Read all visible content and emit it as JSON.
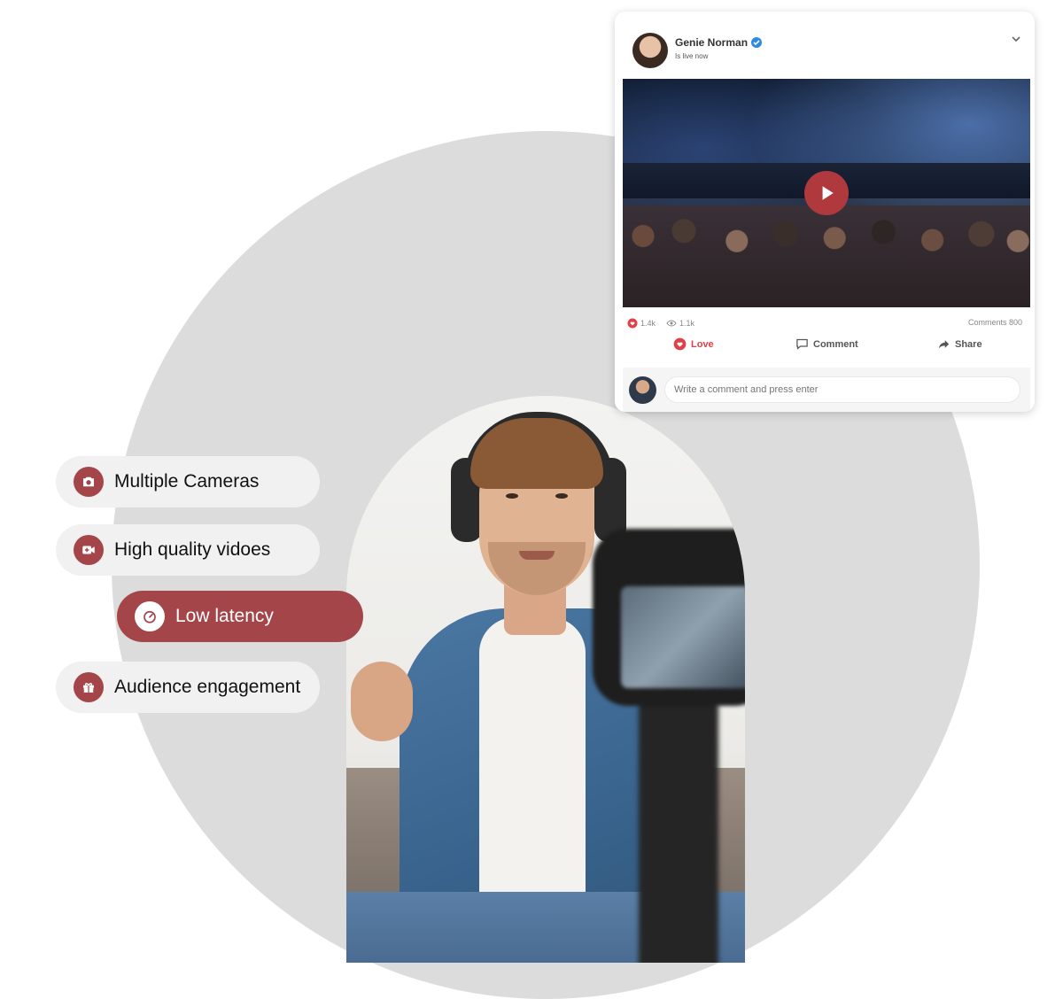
{
  "features": [
    {
      "label": "Multiple Cameras",
      "icon": "camera-icon",
      "active": false
    },
    {
      "label": "High quality vidoes",
      "icon": "video-camera-icon",
      "active": false
    },
    {
      "label": "Low latency",
      "icon": "speedometer-icon",
      "active": true
    },
    {
      "label": "Audience engagement",
      "icon": "gift-icon",
      "active": false
    }
  ],
  "post": {
    "user_name": "Genie Norman",
    "status": "Is live now",
    "likes": "1.4k",
    "views": "1.1k",
    "comments": "Comments 800",
    "love_label": "Love",
    "comment_label": "Comment",
    "share_label": "Share",
    "comment_placeholder": "Write a comment and press enter"
  },
  "colors": {
    "accent": "#a4454a",
    "play_button": "#b0393e",
    "love": "#e0404a",
    "verified": "#2d8ce0",
    "background_circle": "#dcdcdc"
  }
}
